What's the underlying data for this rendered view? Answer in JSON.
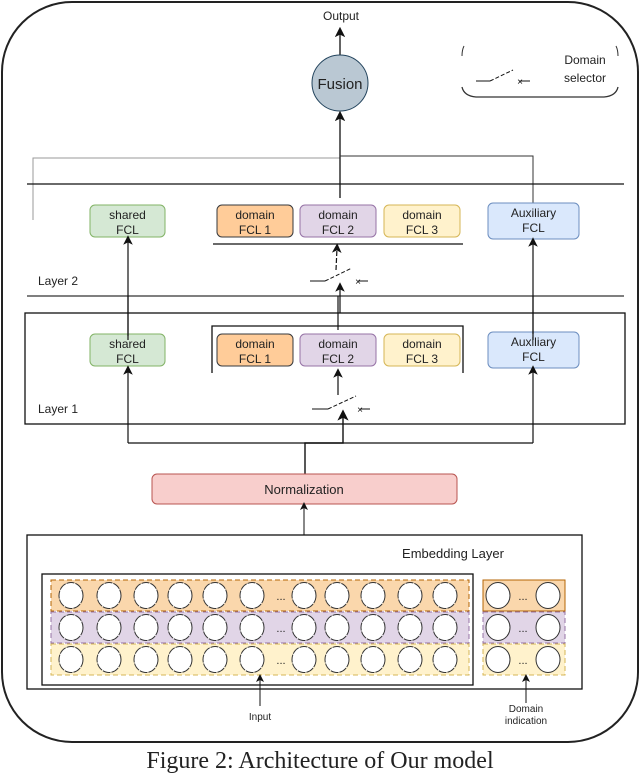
{
  "figure": {
    "output_label": "Output",
    "fusion_label": "Fusion",
    "legend": {
      "line1": "Domain",
      "line2": "selector",
      "symbol": "switch"
    },
    "layers": [
      {
        "name": "Layer 2",
        "shared": {
          "line1": "shared",
          "line2": "FCL"
        },
        "domains": [
          {
            "line1": "domain",
            "line2": "FCL 1"
          },
          {
            "line1": "domain",
            "line2": "FCL 2"
          },
          {
            "line1": "domain",
            "line2": "FCL 3"
          }
        ],
        "auxiliary": {
          "line1": "Auxiliary",
          "line2": "FCL"
        }
      },
      {
        "name": "Layer 1",
        "shared": {
          "line1": "shared",
          "line2": "FCL"
        },
        "domains": [
          {
            "line1": "domain",
            "line2": "FCL 1"
          },
          {
            "line1": "domain",
            "line2": "FCL 2"
          },
          {
            "line1": "domain",
            "line2": "FCL 3"
          }
        ],
        "auxiliary": {
          "line1": "Auxiliary",
          "line2": "FCL"
        }
      }
    ],
    "normalization_label": "Normalization",
    "embedding_label": "Embedding Layer",
    "ellipsis": "...",
    "input_label": "Input",
    "domain_indication": {
      "line1": "Domain",
      "line2": "indication"
    },
    "caption": "Figure 2: Architecture of Our model"
  },
  "colors": {
    "shared_fill": "#d5e8d4",
    "shared_stroke": "#82b366",
    "domain1_fill": "#ffcc99",
    "domain1_stroke": "#36393d",
    "domain2_fill": "#e1d5e7",
    "domain2_stroke": "#9673a6",
    "domain3_fill": "#fff2cc",
    "domain3_stroke": "#d6b656",
    "aux_fill": "#dae8fc",
    "aux_stroke": "#6c8ebf",
    "norm_fill": "#f8cecc",
    "norm_stroke": "#b85450",
    "fusion_fill": "#bac8d3",
    "fusion_stroke": "#23445d",
    "row1_fill": "#fad7ac",
    "row1_stroke": "#b46504",
    "row2_fill": "#e1d5e7",
    "row2_stroke": "#9673a6",
    "row3_fill": "#fff2cc",
    "row3_stroke": "#d6b656"
  }
}
